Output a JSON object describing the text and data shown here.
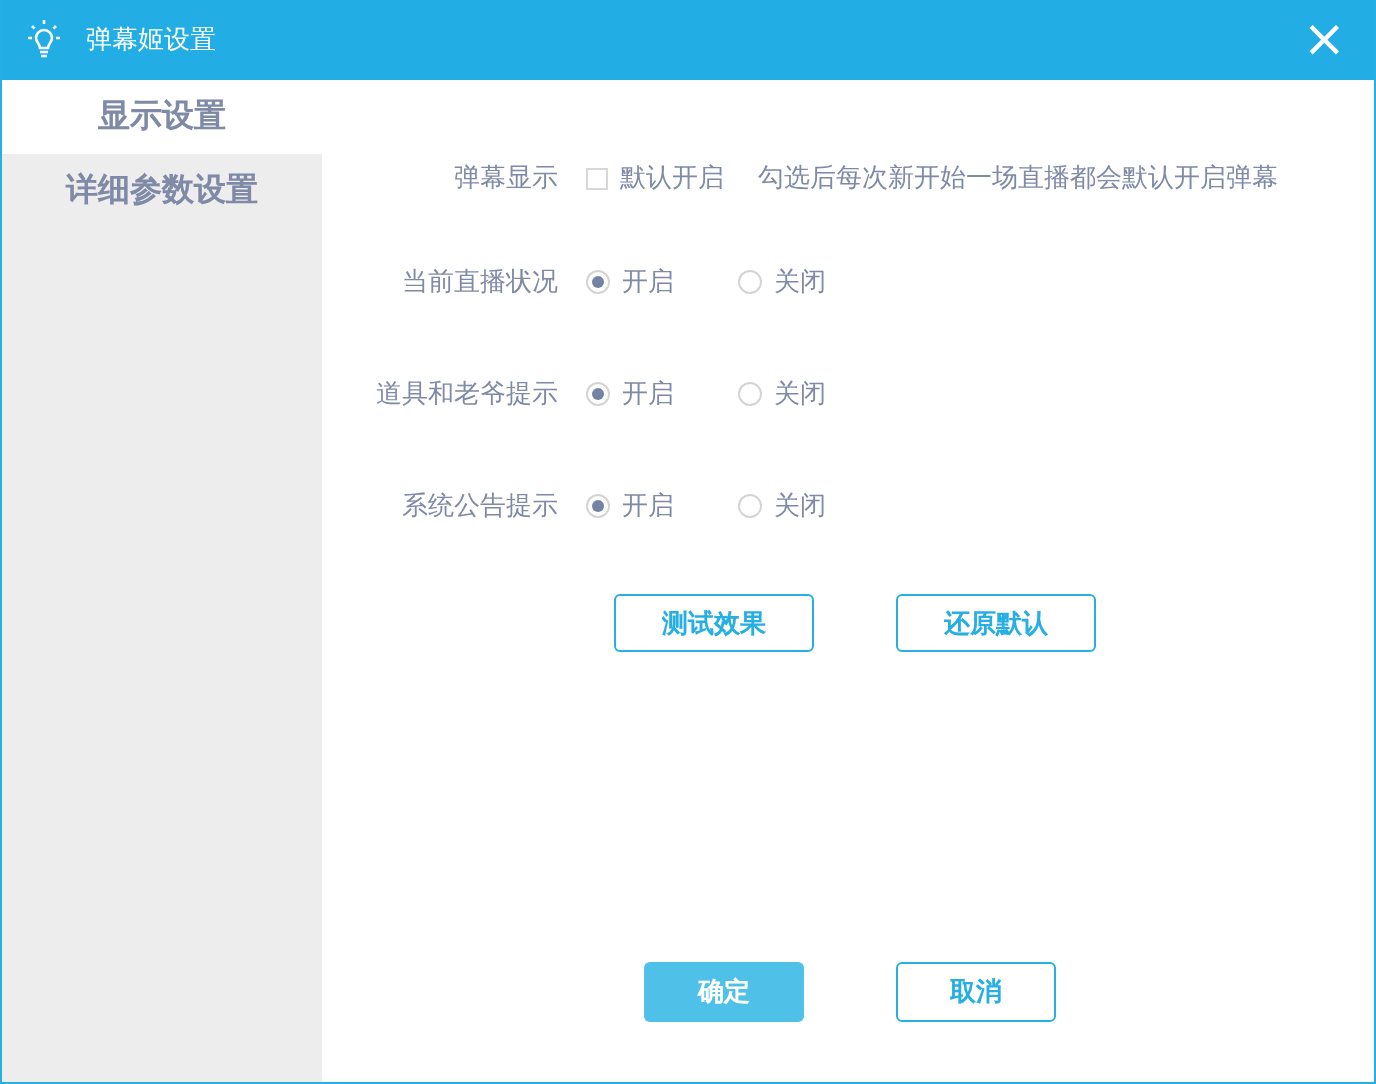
{
  "window": {
    "title": "弹幕姬设置",
    "close": "×"
  },
  "sidebar": {
    "items": [
      {
        "label": "显示设置",
        "selected": true
      },
      {
        "label": "详细参数设置",
        "selected": false
      }
    ]
  },
  "settings": [
    {
      "kind": "checkbox",
      "label": "弹幕显示",
      "option": "默认开启",
      "checked": false,
      "hint": "勾选后每次新开始一场直播都会默认开启弹幕"
    },
    {
      "kind": "radio",
      "label": "当前直播状况",
      "options": [
        {
          "label": "开启",
          "selected": true
        },
        {
          "label": "关闭",
          "selected": false
        }
      ]
    },
    {
      "kind": "radio",
      "label": "道具和老爷提示",
      "options": [
        {
          "label": "开启",
          "selected": true
        },
        {
          "label": "关闭",
          "selected": false
        }
      ]
    },
    {
      "kind": "radio",
      "label": "系统公告提示",
      "options": [
        {
          "label": "开启",
          "selected": true
        },
        {
          "label": "关闭",
          "selected": false
        }
      ]
    }
  ],
  "actions": [
    "测试效果",
    "还原默认"
  ],
  "footer": [
    {
      "label": "确定",
      "kind": "primary"
    },
    {
      "label": "取消",
      "kind": "secondary"
    }
  ]
}
